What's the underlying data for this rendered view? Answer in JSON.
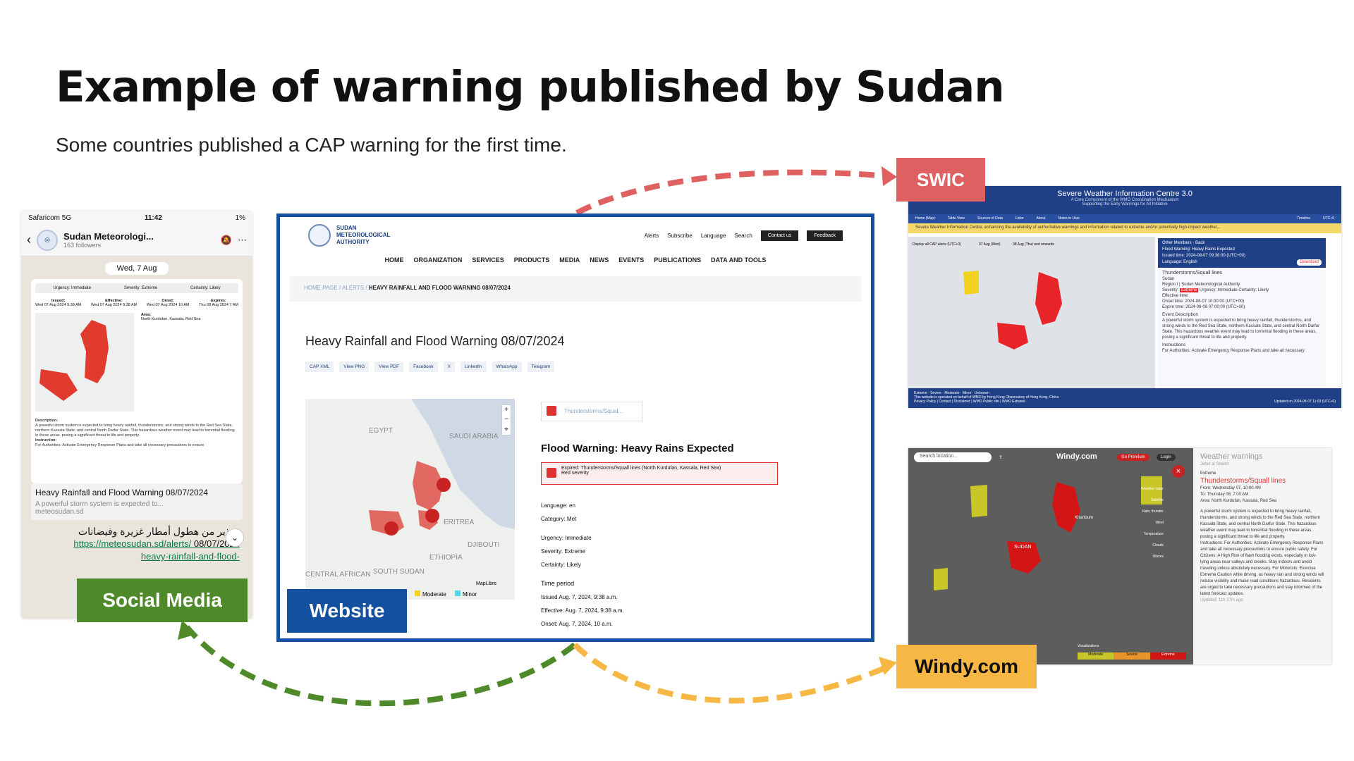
{
  "slide": {
    "title": "Example of warning published by Sudan",
    "subtitle": "Some countries published a CAP warning for the first time."
  },
  "labels": {
    "swic": "SWIC",
    "social": "Social Media",
    "website": "Website",
    "windy": "Windy.com"
  },
  "colors": {
    "swic": "#de6060",
    "social": "#4f8a2a",
    "website": "#1450a0",
    "windy": "#f7b745",
    "warning_red": "#d33"
  },
  "phone": {
    "carrier": "Safaricom 5G",
    "time": "11:42",
    "battery": "1%",
    "channel_name": "Sudan Meteorologi...",
    "followers": "163 followers",
    "date_chip": "Wed, 7 Aug",
    "badges": [
      "Urgency: Immediate",
      "Severity: Extreme",
      "Certainty: Likely"
    ],
    "times": [
      {
        "label": "Issued:",
        "value": "Wed 07 Aug 2024 9:38 AM"
      },
      {
        "label": "Effective:",
        "value": "Wed 07 Aug 2024 9:38 AM"
      },
      {
        "label": "Onset:",
        "value": "Wed 07 Aug 2024 10 AM"
      },
      {
        "label": "Expires:",
        "value": "Thu 08 Aug 2024 7 AM"
      }
    ],
    "area_label": "Area:",
    "area_value": "North Kurdufan, Kassala, Red Sea",
    "description_label": "Description:",
    "description": "A powerful storm system is expected to bring heavy rainfall, thunderstorms, and strong winds to the Red Sea State, northern Kassala State, and central North Darfur State. This hazardous weather event may lead to torrential flooding in these areas, posing a significant threat to life and property.",
    "instruction_label": "Instruction:",
    "instruction": "For Authorities: Activate Emergency Response Plans and take all necessary precautions to ensure",
    "preview_title": "Heavy Rainfall and Flood Warning 08/07/2024",
    "preview_text": "A powerful storm system is expected to...",
    "preview_domain": "meteosudan.sd",
    "arabic_text": "تحذير من هطول أمطار غزيرة وفيضانات",
    "link_line1": "https://meteosudan.sd/alerts/",
    "link_date": "08/07/2024",
    "link_line2": "heavy-rainfall-and-flood-"
  },
  "website": {
    "logo_lines": [
      "SUDAN",
      "METEOROLOGICAL",
      "AUTHORITY"
    ],
    "util_links": [
      "Alerts",
      "Subscribe",
      "Language",
      "Search"
    ],
    "contact": "Contact us",
    "feedback": "Feedback",
    "nav": [
      "HOME",
      "ORGANIZATION",
      "SERVICES",
      "PRODUCTS",
      "MEDIA",
      "NEWS",
      "EVENTS",
      "PUBLICATIONS",
      "DATA AND TOOLS"
    ],
    "breadcrumb": [
      "HOME PAGE",
      "ALERTS",
      "HEAVY RAINFALL AND FLOOD WARNING 08/07/2024"
    ],
    "title": "Heavy Rainfall and Flood Warning 08/07/2024",
    "share": [
      "CAP XML",
      "View PNG",
      "View PDF",
      "Facebook",
      "X",
      "LinkedIn",
      "WhatsApp",
      "Telegram"
    ],
    "map_labels": [
      "EGYPT",
      "SAUDI ARABIA",
      "ERITREA",
      "ETHIOPIA",
      "DJIBOUTI",
      "SOUTH SUDAN",
      "CENTRAL AFRICAN"
    ],
    "map_legend": [
      "Moderate",
      "Minor"
    ],
    "maplibre": "MapLibre",
    "tab": "Thunderstorms/Squal...",
    "warning_title": "Flood Warning: Heavy Rains Expected",
    "expired_line": "Expired: Thunderstorms/Squall lines (North Kurdufan, Kassala, Red Sea)",
    "expired_severity": "Red severity",
    "facts": [
      "Language: en",
      "Category: Met",
      "Urgency: Immediate",
      "Severity: Extreme",
      "Certainty: Likely"
    ],
    "time_period_label": "Time period",
    "time_items": [
      "Issued Aug. 7, 2024, 9:38 a.m.",
      "Effective: Aug. 7, 2024, 9:38 a.m.",
      "Onset: Aug. 7, 2024, 10 a.m."
    ]
  },
  "swic": {
    "header_title": "Severe Weather Information Centre 3.0",
    "header_sub1": "A Core Component of the WMO Coordination Mechanism",
    "header_sub2": "Supporting the Early Warnings for All Initiative",
    "nav": [
      "Home (Map)",
      "Table View",
      "Sources of Data",
      "Links",
      "About",
      "Notes to User"
    ],
    "timeline": "Timeline",
    "timezone": "UTC+0",
    "banner": "Severe Weather Information Centre, enhancing the availability of authoritative warnings and information related to extreme and/or potentially high-impact weather...",
    "map_chips": [
      "Display all CAP alerts (UTC+0)",
      "07 Aug (Wed)",
      "08 Aug (Thu) and onwards"
    ],
    "panel_links": [
      "Other Members",
      "Back"
    ],
    "panel_title": "Flood Warning: Heavy Rains Expected",
    "panel_issued": "Issued time: 2024-08-07 09:38:00 (UTC+00)",
    "panel_language": "Language: English",
    "download": "Download",
    "event": "Thunderstorms/Squall lines",
    "country": "Sudan",
    "region": "Region I  |  Sudan Meteorological Authority",
    "severity_label": "Severity:",
    "severity": "Extreme",
    "urgency_label": "Urgency:",
    "urgency": "Immediate",
    "certainty_label": "Certainty:",
    "certainty": "Likely",
    "effective": "Effective time:",
    "onset": "Onset time: 2024-08-07 10:00:00 (UTC+00)",
    "expire": "Expire time: 2024-08-08 07:00:00 (UTC+00)",
    "event_desc_label": "Event Description",
    "event_desc": "A powerful storm system is expected to bring heavy rainfall, thunderstorms, and strong winds to the Red Sea State, northern Kassala State, and central North Darfur State. This hazardous weather event may lead to torrential flooding in these areas, posing a significant threat to life and property.",
    "instructions_label": "Instructions",
    "instructions": "For Authorities: Activate Emergency Response Plans and take all necessary",
    "legend": [
      "Extreme",
      "Severe",
      "Moderate",
      "Minor",
      "Unknown"
    ],
    "footer_operated": "This website is operated on behalf of WMO by Hong Kong Observatory of Hong Kong, China",
    "footer_links": "Privacy Policy | Contact | Disclaimer | WMO Public site | WMO Extranet",
    "footer_updated": "Updated on 2024-08-07 11:03 (UTC+0)"
  },
  "windy": {
    "search_placeholder": "Search location...",
    "brand": "Windy.com",
    "premium": "Go Premium",
    "login": "Login",
    "map_labels": [
      "SUDAN",
      "Khartoum"
    ],
    "side_title": "Weather warnings",
    "side_place": "Jebel al Sheikh",
    "severity": "Extreme",
    "event": "Thunderstorms/Squall lines",
    "from": "From: Wednesday 07, 10:00 AM",
    "to": "To: Thursday 08, 7:00 AM",
    "area": "Area: North Kurdufan, Kassala, Red Sea",
    "description": "A powerful storm system is expected to bring heavy rainfall, thunderstorms, and strong winds to the Red Sea State, northern Kassala State, and central North Darfur State. This hazardous weather event may lead to torrential flooding in these areas, posing a significant threat to life and property.",
    "instructions": "Instructions: For Authorities: Activate Emergency Response Plans and take all necessary precautions to ensure public safety. For Citizens: A High Risk of flash flooding exists, especially in low-lying areas near valleys and creeks. Stay indoors and avoid traveling unless absolutely necessary. For Motorists: Exercise Extreme Caution while driving, as heavy rain and strong winds will reduce visibility and make road conditions hazardous. Residents are urged to take necessary precautions and stay informed of the latest forecast updates.",
    "updated": "Updated: 11h 27m ago",
    "layer_labels": [
      "Weather radar",
      "Satellite",
      "Rain, thunder",
      "Wind",
      "Temperature",
      "Clouds",
      "Waves"
    ],
    "scale": [
      "Moderate",
      "Severe",
      "Extreme"
    ],
    "visualizations": "Visualizations"
  }
}
